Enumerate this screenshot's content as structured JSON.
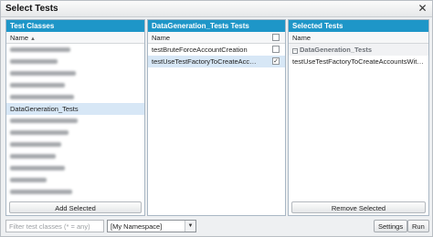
{
  "dialog": {
    "title": "Select Tests",
    "close_glyph": "✕"
  },
  "classes_panel": {
    "header": "Test Classes",
    "column": "Name",
    "sort_glyph": "▲",
    "selected_item": "DataGeneration_Tests",
    "button": "Add Selected"
  },
  "tests_panel": {
    "header": "DataGeneration_Tests Tests",
    "column": "Name",
    "items": [
      {
        "label": "testBruteForceAccountCreation",
        "checked": false
      },
      {
        "label": "testUseTestFactoryToCreateAccountsWithContacts",
        "checked": true
      }
    ],
    "check_glyph": "✓"
  },
  "selected_panel": {
    "header": "Selected Tests",
    "column": "Name",
    "group_toggle": "−",
    "group_label": "DataGeneration_Tests",
    "items": [
      "testUseTestFactoryToCreateAccountsWithContacts"
    ],
    "button": "Remove Selected"
  },
  "bottom": {
    "filter_placeholder": "Filter test classes (* = any)",
    "namespace": "[My Namespace]",
    "namespace_arrow": "▼",
    "settings": "Settings",
    "run": "Run"
  },
  "colors": {
    "panel_header": "#1e96c8",
    "selected_row": "#d7e7f6"
  }
}
